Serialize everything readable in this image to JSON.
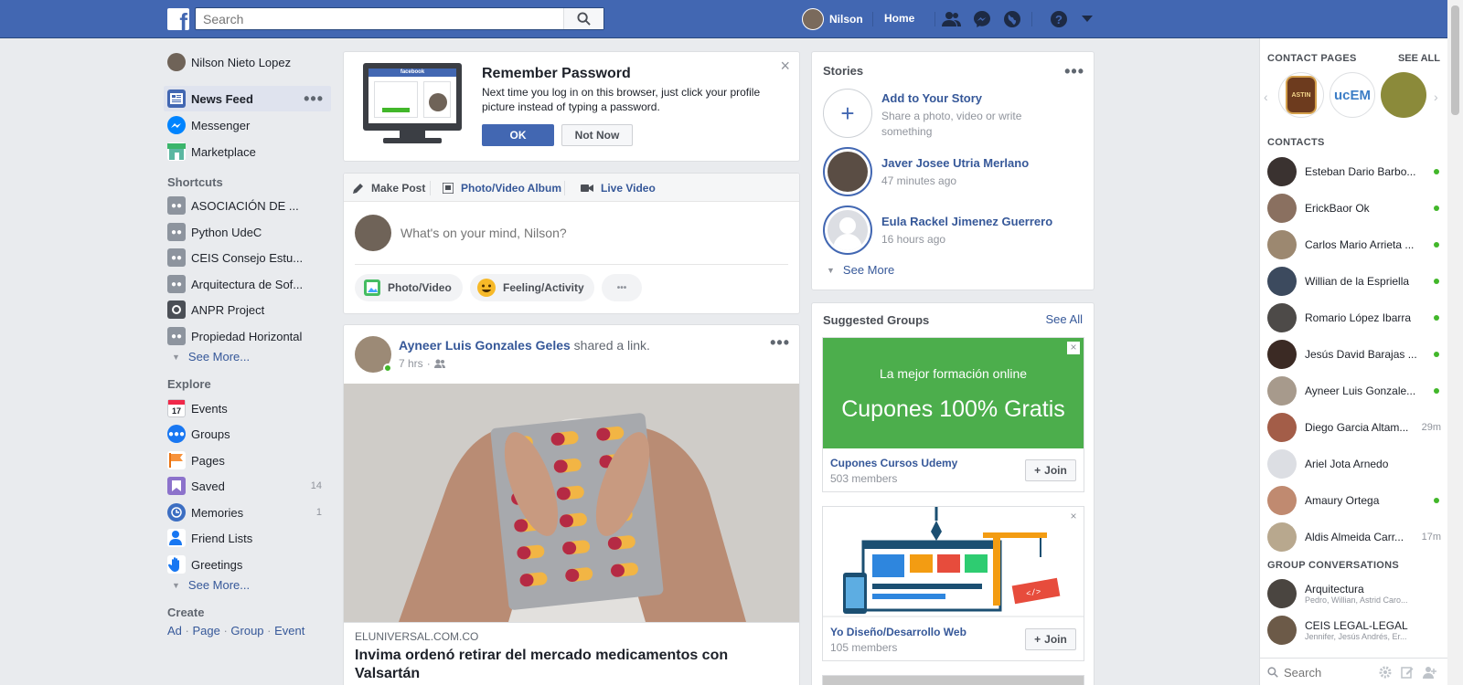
{
  "topbar": {
    "logo": "f",
    "search_placeholder": "Search",
    "user_name": "Nilson",
    "home_label": "Home",
    "icons": [
      "friend-requests-icon",
      "messenger-icon",
      "notifications-globe-icon",
      "help-icon",
      "account-menu-icon"
    ]
  },
  "left_nav": {
    "profile_name": "Nilson Nieto Lopez",
    "main": [
      {
        "label": "News Feed",
        "icon": "news-feed-icon"
      },
      {
        "label": "Messenger",
        "icon": "messenger-icon"
      },
      {
        "label": "Marketplace",
        "icon": "marketplace-icon"
      }
    ],
    "shortcuts_title": "Shortcuts",
    "shortcuts": [
      {
        "label": "ASOCIACIÓN DE ..."
      },
      {
        "label": "Python UdeC"
      },
      {
        "label": "CEIS Consejo Estu..."
      },
      {
        "label": "Arquitectura de Sof..."
      },
      {
        "label": "ANPR Project"
      },
      {
        "label": "Propiedad Horizontal"
      }
    ],
    "see_more": "See More...",
    "explore_title": "Explore",
    "explore": [
      {
        "label": "Events",
        "count": ""
      },
      {
        "label": "Groups",
        "count": ""
      },
      {
        "label": "Pages",
        "count": ""
      },
      {
        "label": "Saved",
        "count": "14"
      },
      {
        "label": "Memories",
        "count": "1"
      },
      {
        "label": "Friend Lists",
        "count": ""
      },
      {
        "label": "Greetings",
        "count": ""
      }
    ],
    "events_day": "17",
    "create_title": "Create",
    "create_links": [
      "Ad",
      "Page",
      "Group",
      "Event"
    ]
  },
  "remember": {
    "title": "Remember Password",
    "text": "Next time you log in on this browser, just click your profile picture instead of typing a password.",
    "ok": "OK",
    "not_now": "Not Now",
    "close": "×",
    "illustration_brand": "facebook"
  },
  "composer": {
    "tabs": [
      "Make Post",
      "Photo/Video Album",
      "Live Video"
    ],
    "placeholder": "What's on your mind, Nilson?",
    "actions": [
      "Photo/Video",
      "Feeling/Activity"
    ],
    "more": "•••"
  },
  "post": {
    "author": "Ayneer Luis Gonzales Geles",
    "action": " shared a link.",
    "time": "7 hrs",
    "link_domain": "ELUNIVERSAL.COM.CO",
    "link_title": "Invima ordenó retirar del mercado medicamentos con Valsartán"
  },
  "stories": {
    "title": "Stories",
    "add_title": "Add to Your Story",
    "add_sub": "Share a photo, video or write something",
    "items": [
      {
        "name": "Javer Josee Utria Merlano",
        "time": "47 minutes ago"
      },
      {
        "name": "Eula Rackel Jimenez Guerrero",
        "time": "16 hours ago"
      }
    ],
    "see_more": "See More"
  },
  "groups": {
    "title": "Suggested Groups",
    "see_all": "See All",
    "items": [
      {
        "banner_line1": "La mejor formación online",
        "banner_line2": "Cupones 100% Gratis",
        "name": "Cupones Cursos Udemy",
        "members": "503 members",
        "join": "Join"
      },
      {
        "name": "Yo Diseño/Desarrollo Web",
        "members": "105 members",
        "join": "Join"
      }
    ]
  },
  "chat": {
    "contact_pages_title": "CONTACT PAGES",
    "see_all": "SEE ALL",
    "page_badges": [
      "ASTIN",
      "ucEM"
    ],
    "contacts_title": "CONTACTS",
    "contacts": [
      {
        "name": "Esteban Dario Barbo...",
        "status": "online",
        "time": ""
      },
      {
        "name": "ErickBaor Ok",
        "status": "online",
        "time": ""
      },
      {
        "name": "Carlos Mario Arrieta ...",
        "status": "online",
        "time": ""
      },
      {
        "name": "Willian de la Espriella",
        "status": "online",
        "time": ""
      },
      {
        "name": "Romario López Ibarra",
        "status": "online",
        "time": ""
      },
      {
        "name": "Jesús David Barajas ...",
        "status": "online",
        "time": ""
      },
      {
        "name": "Ayneer Luis Gonzale...",
        "status": "online",
        "time": ""
      },
      {
        "name": "Diego Garcia Altam...",
        "status": "away",
        "time": "29m"
      },
      {
        "name": "Ariel Jota Arnedo",
        "status": "offline",
        "time": ""
      },
      {
        "name": "Amaury Ortega",
        "status": "online",
        "time": ""
      },
      {
        "name": "Aldis Almeida Carr...",
        "status": "away",
        "time": "17m"
      }
    ],
    "group_conv_title": "GROUP CONVERSATIONS",
    "groups": [
      {
        "name": "Arquitectura",
        "members": "Pedro, Willian, Astrid Caro..."
      },
      {
        "name": "CEIS LEGAL-LEGAL",
        "members": "Jennifer, Jesús Andrés, Er..."
      }
    ],
    "search_placeholder": "Search"
  },
  "colors": {
    "brand": "#4267b2",
    "link": "#365899",
    "online": "#42b72a",
    "green_banner": "#4cae4c"
  }
}
